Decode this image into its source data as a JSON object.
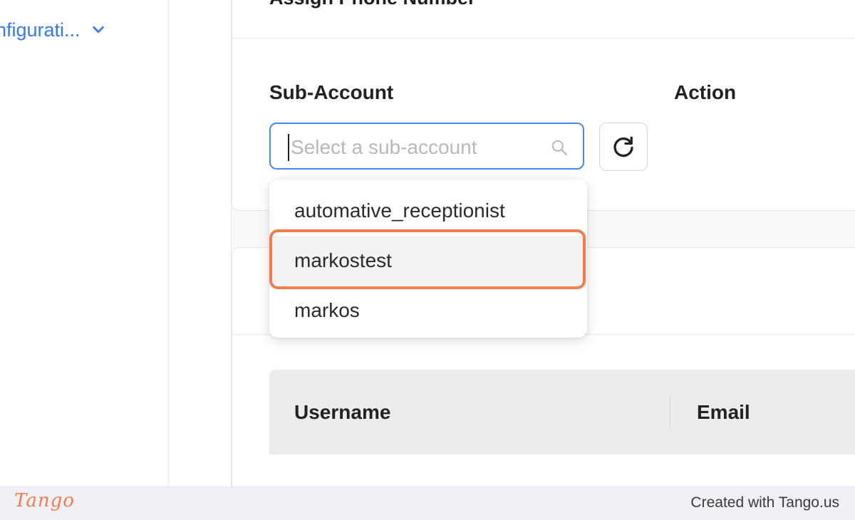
{
  "sidebar": {
    "nav_item_label": "nfigurati...",
    "accent_color": "#3478f6"
  },
  "assign_card": {
    "title": "Assign Phone Number",
    "sub_account_label": "Sub-Account",
    "action_label": "Action",
    "select": {
      "value": "",
      "placeholder": "Select a sub-account"
    }
  },
  "dropdown": {
    "options": [
      {
        "label": "automative_receptionist"
      },
      {
        "label": "markostest",
        "highlighted": true
      },
      {
        "label": "markos"
      }
    ],
    "highlight_color": "#f37c4a"
  },
  "table": {
    "columns": [
      "Username",
      "Email"
    ]
  },
  "footer": {
    "logo_text": "Tango",
    "credit": "Created with Tango.us"
  }
}
